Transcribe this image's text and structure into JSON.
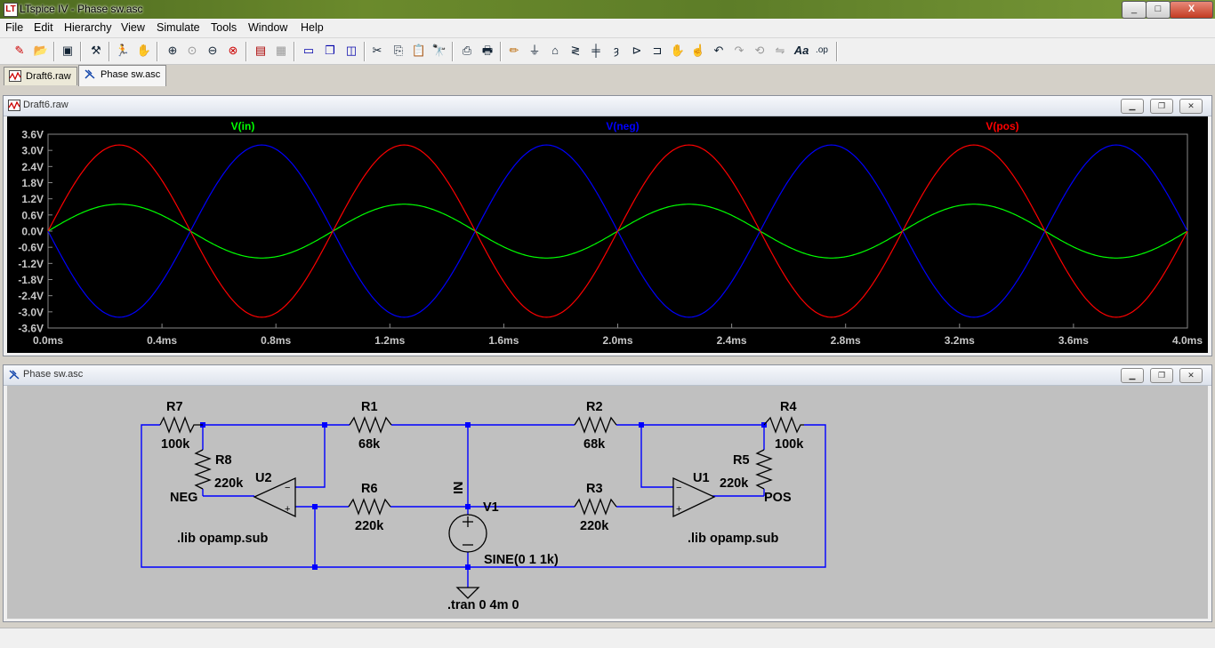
{
  "window": {
    "title": "LTspice IV - Phase sw.asc",
    "controls": {
      "minimize": "_",
      "maximize": "□",
      "close": "X"
    }
  },
  "menu": [
    "File",
    "Edit",
    "Hierarchy",
    "View",
    "Simulate",
    "Tools",
    "Window",
    "Help"
  ],
  "toolbar_icons": [
    "new-schematic-icon",
    "open-icon",
    "save-icon",
    "control-panel-icon",
    "run-icon",
    "halt-icon",
    "zoom-in-icon",
    "zoom-pan-icon",
    "zoom-out-icon",
    "zoom-cancel-icon",
    "autorange-icon",
    "grid-icon",
    "tile-horizontal-icon",
    "cascade-icon",
    "tile-vertical-icon",
    "cut-icon",
    "copy-icon",
    "paste-icon",
    "find-icon",
    "print-setup-icon",
    "print-icon",
    "wire-icon",
    "ground-icon",
    "label-net-icon",
    "resistor-icon",
    "capacitor-icon",
    "inductor-icon",
    "diode-icon",
    "component-icon",
    "move-icon",
    "drag-icon",
    "undo-icon",
    "redo-icon",
    "rotate-icon",
    "mirror-icon",
    "text-icon",
    "spice-directive-icon"
  ],
  "tabs": [
    {
      "label": "Draft6.raw",
      "icon": "waveform-icon",
      "active": false
    },
    {
      "label": "Phase sw.asc",
      "icon": "schematic-icon",
      "active": true
    }
  ],
  "plot_window": {
    "title": "Draft6.raw"
  },
  "schematic_window": {
    "title": "Phase sw.asc"
  },
  "chart_data": {
    "type": "line",
    "x_tick_labels": [
      "0.0ms",
      "0.4ms",
      "0.8ms",
      "1.2ms",
      "1.6ms",
      "2.0ms",
      "2.4ms",
      "2.8ms",
      "3.2ms",
      "3.6ms",
      "4.0ms"
    ],
    "y_tick_labels": [
      "3.6V",
      "3.0V",
      "2.4V",
      "1.8V",
      "1.2V",
      "0.6V",
      "0.0V",
      "-0.6V",
      "-1.2V",
      "-1.8V",
      "-2.4V",
      "-3.0V",
      "-3.6V"
    ],
    "xlim": [
      0,
      4
    ],
    "ylim": [
      -3.6,
      3.6
    ],
    "grid": false,
    "background": "#000000",
    "series": [
      {
        "name": "V(in)",
        "color": "#00ff00",
        "amplitude": 1.0,
        "frequency_khz": 1,
        "phase_sign": 1
      },
      {
        "name": "V(neg)",
        "color": "#0000ff",
        "amplitude": 3.2,
        "frequency_khz": 1,
        "phase_sign": -1
      },
      {
        "name": "V(pos)",
        "color": "#ff0000",
        "amplitude": 3.2,
        "frequency_khz": 1,
        "phase_sign": 1
      }
    ]
  },
  "schematic": {
    "components": [
      {
        "ref": "R7",
        "value": "100k"
      },
      {
        "ref": "R8",
        "value": "220k"
      },
      {
        "ref": "R1",
        "value": "68k"
      },
      {
        "ref": "R6",
        "value": "220k"
      },
      {
        "ref": "R2",
        "value": "68k"
      },
      {
        "ref": "R3",
        "value": "220k"
      },
      {
        "ref": "R4",
        "value": "100k"
      },
      {
        "ref": "R5",
        "value": "220k"
      },
      {
        "ref": "U1",
        "value": ".lib opamp.sub"
      },
      {
        "ref": "U2",
        "value": ".lib opamp.sub"
      },
      {
        "ref": "V1",
        "value": "SINE(0 1 1k)"
      }
    ],
    "net_labels": {
      "neg": "NEG",
      "pos": "POS",
      "in": "IN"
    },
    "directive": ".tran 0 4m 0",
    "wire_color": "#0000ff",
    "background": "#c0c0c0"
  }
}
